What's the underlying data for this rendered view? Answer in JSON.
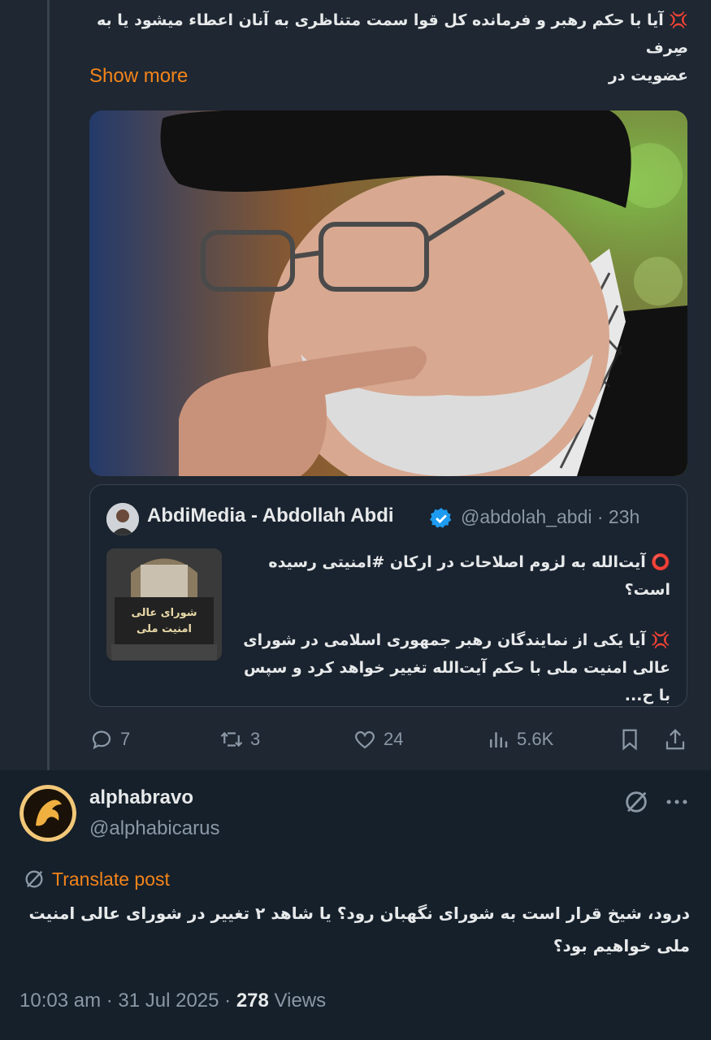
{
  "top_tweet": {
    "text_line1": "💢 آیا با حکم رهبر و فرمانده کل قوا سمت متناظری به آنان اعطاء میشود یا به صِرف",
    "text_line2": "عضویت در",
    "show_more": "Show more",
    "image_alt": "photo of Ayatollah Khamenei"
  },
  "quoted": {
    "name": "AbdiMedia - Abdollah Abdi",
    "handle": "@abdolah_abdi · 23h",
    "line1": "⭕ آیت‌الله به لزوم اصلاحات در ارکان #امنیتی رسیده",
    "line2": "است؟",
    "line3": "💢 آیا یکی از نمایندگان رهبر جمهوری اسلامی در شورای",
    "line4": "عالی امنیت ملی با حکم آیت‌الله تغییر خواهد کرد و سپس با ح...",
    "thumb_sign": "شورای عالی امنیت ملی"
  },
  "actions": {
    "replies": "7",
    "reposts": "3",
    "likes": "24",
    "views": "5.6K"
  },
  "reply": {
    "name": "alphabravo",
    "handle": "@alphabicarus",
    "translate": "Translate post",
    "text_line1": "درود، شیخ قرار است به شورای نگهبان رود؟ یا شاهد ۲ تغییر در شورای عالی امنیت",
    "text_line2": "ملی خواهیم بود؟",
    "time": "10:03 am · 31 Jul 2025 · ",
    "views_count": "278",
    "views_label": " Views"
  },
  "colors": {
    "accent": "#f4841a",
    "bg_top": "#1e2732",
    "bg_bottom": "#15202b",
    "muted": "#8b98a5",
    "verified": "#1d9bf0"
  }
}
